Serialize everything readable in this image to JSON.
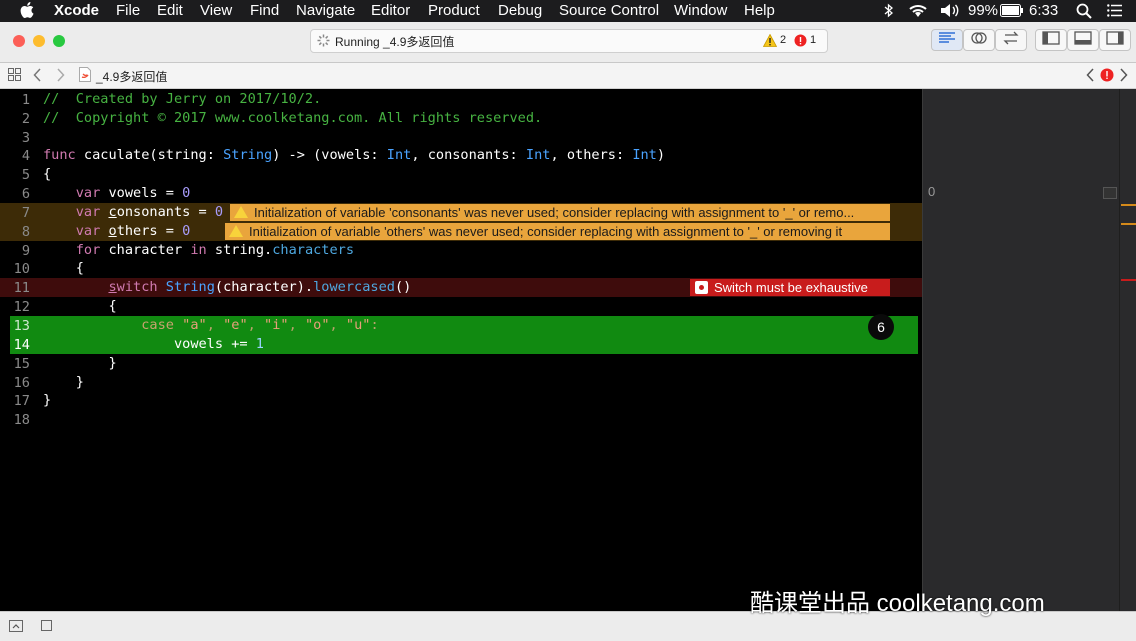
{
  "menubar": {
    "app": "Xcode",
    "items": [
      "File",
      "Edit",
      "View",
      "Find",
      "Navigate",
      "Editor",
      "Product",
      "Debug",
      "Source Control",
      "Window",
      "Help"
    ],
    "battery": "99%",
    "time": "6:33"
  },
  "toolbar": {
    "status": "Running _4.9多返回值",
    "warning_count": "2",
    "error_count": "1"
  },
  "jumpbar": {
    "file": "_4.9多返回值"
  },
  "editor": {
    "line_numbers": [
      "1",
      "2",
      "3",
      "4",
      "5",
      "6",
      "7",
      "8",
      "9",
      "10",
      "11",
      "12",
      "13",
      "14",
      "15",
      "16",
      "17",
      "18"
    ],
    "comment1": "//  Created by Jerry on 2017/10/2.",
    "comment2": "//  Copyright © 2017 www.coolketang.com. All rights reserved.",
    "warning1": "Initialization of variable 'consonants' was never used; consider replacing with assignment to '_' or remo...",
    "warning2": "Initialization of variable 'others' was never used; consider replacing with assignment to '_' or removing it",
    "error1": "Switch must be exhaustive",
    "exec_count": "6"
  },
  "minimap": {
    "value": "0"
  },
  "watermark": "酷课堂出品 coolketang.com",
  "colors": {
    "warning_bg": "#e9a53c",
    "error_bg": "#c81c1c",
    "highlight_bg": "#118a11"
  }
}
